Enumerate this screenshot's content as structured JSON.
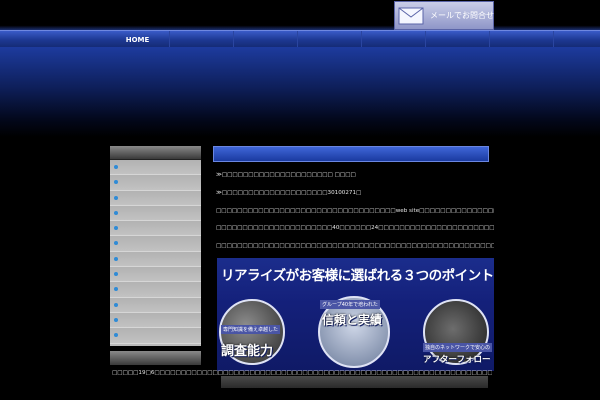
{
  "header": {
    "mail_button_label": "メールでお問合せ"
  },
  "nav": {
    "items": [
      {
        "label": "HOME"
      },
      {
        "label": ""
      },
      {
        "label": ""
      },
      {
        "label": ""
      },
      {
        "label": ""
      },
      {
        "label": ""
      },
      {
        "label": ""
      }
    ]
  },
  "sidebar": {
    "items": [
      "",
      "",
      "",
      "",
      "",
      "",
      "",
      "",
      "",
      "",
      "",
      "",
      ""
    ]
  },
  "main": {
    "lines": [
      "≫□□□□□□□□□□□□□□□□□□□□□ □□□□",
      "≫□□□□□□□□□□□□□□□□□□□□30100271□",
      "□□□□□□□□□□□□□□□□□□□□□□□□□□□□□□□□□□web site□□□□□□□□□□□□□□□□□□□□□□□□□□□□□□□□□□",
      "□□□□□□□□□□□□□□□□□□□□□□40□□□□□□24□□□□□□□□□□□□□□□□□□□□□□□□□□□□□□□□□□□□□□□□□□□100□□□□",
      "□□□□□□□□□□□□□□□□□□□□□□□□□□□□□□□□□□□□□□□□□□□□□□□□□□□□□□□□□□□□□□□□□□□□□□□□□□□□□"
    ],
    "banner": {
      "title": "リアライズがお客様に選ばれる３つのポイント!!",
      "point1_caption": "専門知識を備え卓越した",
      "point1_title": "調査能力",
      "point2_caption": "グループ40年で培われた",
      "point2_title": "信頼と実績",
      "point3_caption": "独自のネットワークで安心の",
      "point3_title": "アフターフォロー"
    },
    "footer_text": "□□□□□19□6□□□□□□□□□□□□□□□□□□□□□□□□□□□□□□□□□□□□□□□□□□□□□□□□□□□□□□□□□□□□□□□□□□□□□□□□"
  }
}
